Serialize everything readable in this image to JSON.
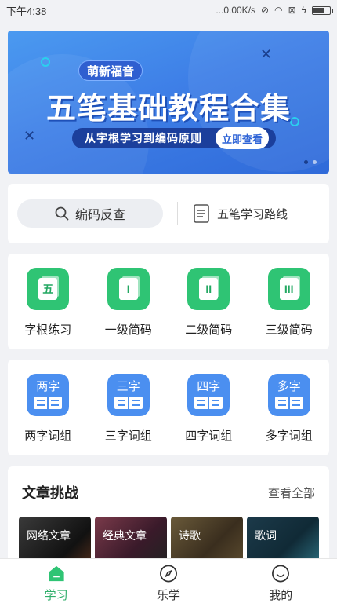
{
  "statusbar": {
    "time": "下午4:38",
    "speed": "...0.00K/s"
  },
  "banner": {
    "brand": "萌新福音",
    "title": "五笔基础教程合集",
    "subtitle": "从字根学习到编码原则",
    "button": "立即查看"
  },
  "search": {
    "placeholder": "编码反查",
    "route_label": "五笔学习路线"
  },
  "grid1": [
    {
      "glyph": "五",
      "label": "字根练习"
    },
    {
      "glyph": "I",
      "label": "一级简码"
    },
    {
      "glyph": "II",
      "label": "二级简码"
    },
    {
      "glyph": "III",
      "label": "三级简码"
    }
  ],
  "grid2": [
    {
      "glyph": "两字",
      "label": "两字词组"
    },
    {
      "glyph": "三字",
      "label": "三字词组"
    },
    {
      "glyph": "四字",
      "label": "四字词组"
    },
    {
      "glyph": "多字",
      "label": "多字词组"
    }
  ],
  "articles": {
    "title": "文章挑战",
    "view_all": "查看全部",
    "tiles": [
      "网络文章",
      "经典文章",
      "诗歌",
      "歌词"
    ]
  },
  "nav": [
    {
      "label": "学习",
      "icon": "home-icon"
    },
    {
      "label": "乐学",
      "icon": "compass-icon"
    },
    {
      "label": "我的",
      "icon": "profile-icon"
    }
  ],
  "colors": {
    "accent_green": "#2fc474",
    "accent_blue": "#4b8ff0",
    "banner_blue": "#3e7fe7"
  }
}
